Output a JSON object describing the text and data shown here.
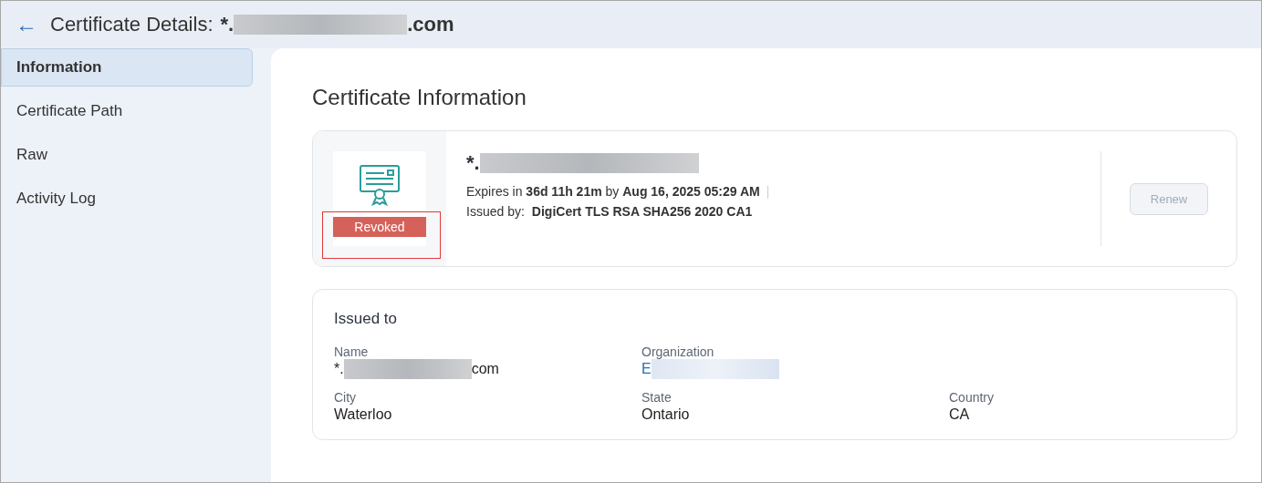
{
  "header": {
    "back": "←",
    "title": "Certificate Details:",
    "domain_prefix": "*.",
    "domain_suffix": ".com"
  },
  "sidebar": {
    "items": [
      {
        "label": "Information",
        "selected": true
      },
      {
        "label": "Certificate Path",
        "selected": false
      },
      {
        "label": "Raw",
        "selected": false
      },
      {
        "label": "Activity Log",
        "selected": false
      }
    ]
  },
  "main": {
    "heading": "Certificate Information",
    "certificate": {
      "status": "Revoked",
      "highlighted": true,
      "name_prefix": "*.",
      "expires_label": "Expires in",
      "expires_in": "36d 11h 21m",
      "by": "by",
      "expires_on": "Aug 16, 2025 05:29 AM",
      "issued_by_label": "Issued by:",
      "issuer": "DigiCert TLS RSA SHA256 2020 CA1",
      "renew": {
        "label": "Renew",
        "disabled": true
      }
    },
    "issued_to": {
      "title": "Issued to",
      "rows": [
        [
          {
            "kind": "redacted",
            "label": "Name",
            "value": "*.",
            "value_suffix": "com"
          },
          {
            "kind": "redacted_link",
            "label": "Organization",
            "value": "E"
          }
        ],
        [
          {
            "kind": "plain",
            "label": "City",
            "value": "Waterloo"
          },
          {
            "kind": "plain",
            "label": "State",
            "value": "Ontario"
          },
          {
            "kind": "plain",
            "label": "Country",
            "value": "CA"
          }
        ]
      ]
    }
  }
}
